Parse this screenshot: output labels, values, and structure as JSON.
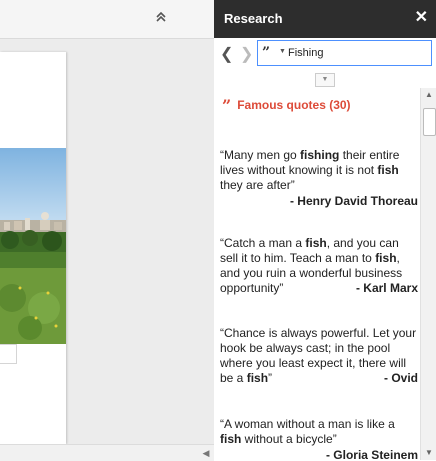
{
  "panel": {
    "title": "Research",
    "close_icon": "✕"
  },
  "search": {
    "value": "Fishing",
    "back_icon": "❮",
    "forward_icon": "❯",
    "source_icon": "quote-icon",
    "source_glyph": "”",
    "caret": "▼"
  },
  "doc": {
    "collapse_icon": "»"
  },
  "results": {
    "heading": "Famous quotes (30)",
    "heading_glyph": "”",
    "quotes": [
      {
        "parts": [
          "“Many men go ",
          "fishing",
          " their entire lives without knowing it is not ",
          "fish",
          " they are after”"
        ],
        "author": "- Henry David Thoreau"
      },
      {
        "parts": [
          "“Catch a man a ",
          "fish",
          ", and you can sell it to him. Teach a man to ",
          "fish",
          ", and you ruin a wonderful business opportunity”"
        ],
        "author": "- Karl Marx"
      },
      {
        "parts": [
          "“Chance is always powerful. Let your hook be always cast; in the pool where you least expect it, there will be a ",
          "fish",
          "”"
        ],
        "author": "- Ovid"
      },
      {
        "parts": [
          "“A woman without a man is like a ",
          "fish",
          " without a bicycle”"
        ],
        "author": "- Gloria Steinem"
      }
    ]
  },
  "colors": {
    "header_bg": "#2d2d2d",
    "accent_red": "#dd4b39",
    "search_border": "#4d90fe"
  }
}
